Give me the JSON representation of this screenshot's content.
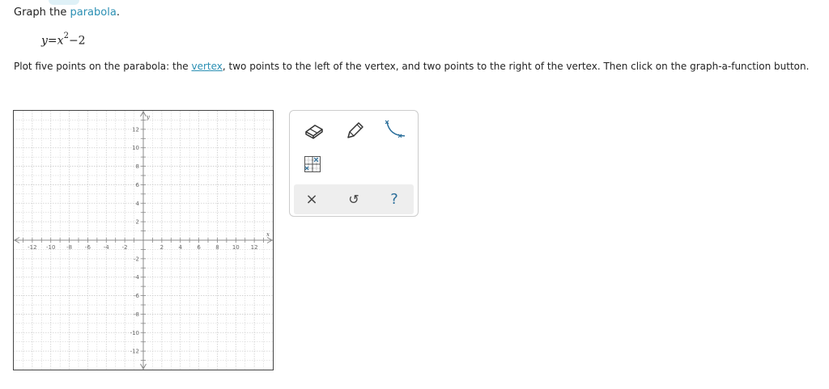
{
  "prompt": {
    "prefix": "Graph the ",
    "term": "parabola",
    "suffix": "."
  },
  "equation": {
    "lhs": "y",
    "equals": "=",
    "var": "x",
    "exponent": "2",
    "rest": "−2"
  },
  "instructions": {
    "part1": "Plot five points on the parabola: the ",
    "link": "vertex",
    "part2": ", two points to the left of the vertex, and two points to the right of the vertex. Then click on the graph-a-function button."
  },
  "graph": {
    "x_label": "x",
    "y_label": "y",
    "x_range": [
      -14,
      14
    ],
    "y_range": [
      -14,
      14
    ],
    "labeled_ticks": [
      -12,
      -10,
      -8,
      -6,
      -4,
      -2,
      2,
      4,
      6,
      8,
      10,
      12
    ],
    "grid_color": "#cccccc",
    "axis_color": "#888888"
  },
  "toolbox": {
    "tools": [
      {
        "name": "eraser-icon"
      },
      {
        "name": "pencil-icon"
      },
      {
        "name": "parabola-tool-icon"
      },
      {
        "name": "graph-function-icon"
      }
    ],
    "actions": {
      "clear": "×",
      "undo": "↺",
      "help": "?"
    },
    "accent_color": "#2a6e9a"
  }
}
